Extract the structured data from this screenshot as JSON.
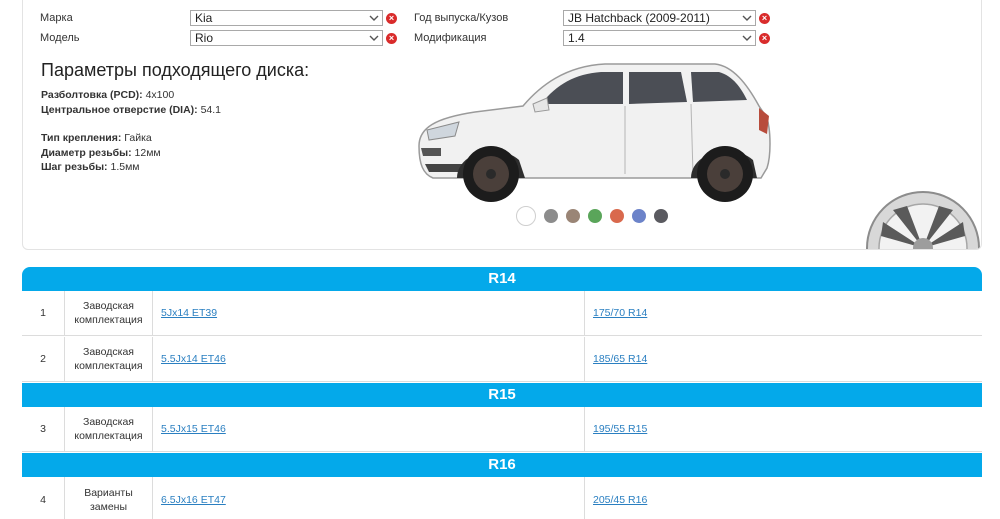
{
  "selectors": {
    "brand": {
      "label": "Марка",
      "value": "Kia"
    },
    "model": {
      "label": "Модель",
      "value": "Rio"
    },
    "year": {
      "label": "Год выпуска/Кузов",
      "value": "JB Hatchback (2009-2011)"
    },
    "modification": {
      "label": "Модификация",
      "value": "1.4"
    }
  },
  "params": {
    "title": "Параметры подходящего диска:",
    "pcd_label": "Разболтовка (PCD):",
    "pcd_value": "4x100",
    "dia_label": "Центральное отверстие (DIA):",
    "dia_value": "54.1",
    "mount_label": "Тип крепления:",
    "mount_value": "Гайка",
    "thread_d_label": "Диаметр резьбы:",
    "thread_d_value": "12мм",
    "thread_p_label": "Шаг резьбы:",
    "thread_p_value": "1.5мм"
  },
  "colors": {
    "swatches": [
      "#ffffff",
      "#8c8c8c",
      "#9a8576",
      "#5aa55a",
      "#d9694d",
      "#6c83c9",
      "#5a5a60"
    ],
    "accent": "#04a9ea",
    "link": "#2a7fc1"
  },
  "table": {
    "groups": [
      {
        "size": "R14",
        "rows": [
          {
            "num": "1",
            "type": "Заводская комплектация",
            "disk": "5Jx14 ET39",
            "tire": "175/70 R14"
          },
          {
            "num": "2",
            "type": "Заводская комплектация",
            "disk": "5.5Jx14 ET46",
            "tire": "185/65 R14"
          }
        ]
      },
      {
        "size": "R15",
        "rows": [
          {
            "num": "3",
            "type": "Заводская комплектация",
            "disk": "5.5Jx15 ET46",
            "tire": "195/55 R15"
          }
        ]
      },
      {
        "size": "R16",
        "rows": [
          {
            "num": "4",
            "type": "Варианты замены",
            "disk": "6.5Jx16 ET47",
            "tire": "205/45 R16"
          }
        ]
      }
    ]
  }
}
